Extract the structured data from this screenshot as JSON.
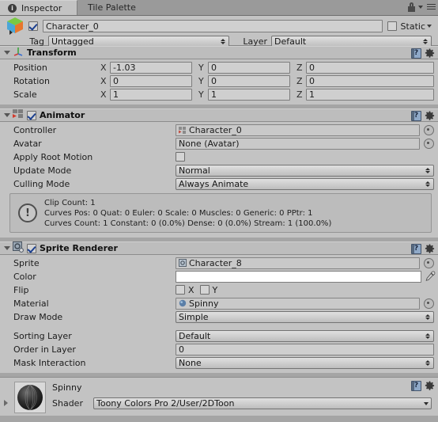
{
  "window": {
    "tabs": [
      {
        "label": "Inspector",
        "icon": "info-icon",
        "active": true
      },
      {
        "label": "Tile Palette",
        "icon": "",
        "active": false
      }
    ],
    "lock_icon": "lock-icon",
    "menu_icon": "hamburger-menu-icon"
  },
  "object_header": {
    "enabled_checkbox": true,
    "icon": "gameobject-cube-icon",
    "name": "Character_0",
    "static_label": "Static",
    "static_checked": false,
    "tag_label": "Tag",
    "tag_value": "Untagged",
    "layer_label": "Layer",
    "layer_value": "Default"
  },
  "components": [
    {
      "name": "Transform",
      "icon": "transform-axis-icon",
      "has_checkbox": false,
      "expanded": true,
      "help_icon": "help-icon",
      "gear_icon": "gear-icon",
      "rows": [
        {
          "label": "Position",
          "x": "-1.03",
          "y": "0",
          "z": "0"
        },
        {
          "label": "Rotation",
          "x": "0",
          "y": "0",
          "z": "0"
        },
        {
          "label": "Scale",
          "x": "1",
          "y": "1",
          "z": "1"
        }
      ],
      "axis_labels": {
        "x": "X",
        "y": "Y",
        "z": "Z"
      }
    },
    {
      "name": "Animator",
      "icon": "animator-icon",
      "has_checkbox": true,
      "checked": true,
      "expanded": true,
      "help_icon": "help-icon",
      "gear_icon": "gear-icon",
      "fields": {
        "controller_label": "Controller",
        "controller_value": "Character_0",
        "controller_icon": "animator-controller-icon",
        "avatar_label": "Avatar",
        "avatar_value": "None (Avatar)",
        "apply_root_motion_label": "Apply Root Motion",
        "apply_root_motion_checked": false,
        "update_mode_label": "Update Mode",
        "update_mode_value": "Normal",
        "culling_mode_label": "Culling Mode",
        "culling_mode_value": "Always Animate"
      },
      "infobox": {
        "icon": "warning-icon",
        "line1": "Clip Count: 1",
        "line2": "Curves Pos: 0 Quat: 0 Euler: 0 Scale: 0 Muscles: 0 Generic: 0 PPtr: 1",
        "line3": "Curves Count: 1 Constant: 0 (0.0%) Dense: 0 (0.0%) Stream: 1 (100.0%)"
      }
    },
    {
      "name": "Sprite Renderer",
      "icon": "sprite-renderer-icon",
      "has_checkbox": true,
      "checked": true,
      "expanded": true,
      "help_icon": "help-icon",
      "gear_icon": "gear-icon",
      "fields": {
        "sprite_label": "Sprite",
        "sprite_value": "Character_8",
        "sprite_icon": "sprite-asset-icon",
        "color_label": "Color",
        "color_value": "#FFFFFF",
        "eyedropper_icon": "eyedropper-icon",
        "flip_label": "Flip",
        "flip_x_label": "X",
        "flip_x_checked": false,
        "flip_y_label": "Y",
        "flip_y_checked": false,
        "material_label": "Material",
        "material_value": "Spinny",
        "material_icon": "material-sphere-icon",
        "draw_mode_label": "Draw Mode",
        "draw_mode_value": "Simple",
        "sorting_layer_label": "Sorting Layer",
        "sorting_layer_value": "Default",
        "order_in_layer_label": "Order in Layer",
        "order_in_layer_value": "0",
        "mask_interaction_label": "Mask Interaction",
        "mask_interaction_value": "None"
      }
    }
  ],
  "material_footer": {
    "preview_icon": "material-preview-sphere",
    "name": "Spinny",
    "shader_label": "Shader",
    "shader_value": "Toony Colors Pro 2/User/2DToon",
    "help_icon": "help-icon",
    "gear_icon": "gear-icon"
  },
  "colors": {
    "panel": "#c3c3c3",
    "header": "#bdbdbd",
    "background": "#a5a5a5",
    "field": "#cfcfcf",
    "text": "#1c1c1c"
  }
}
